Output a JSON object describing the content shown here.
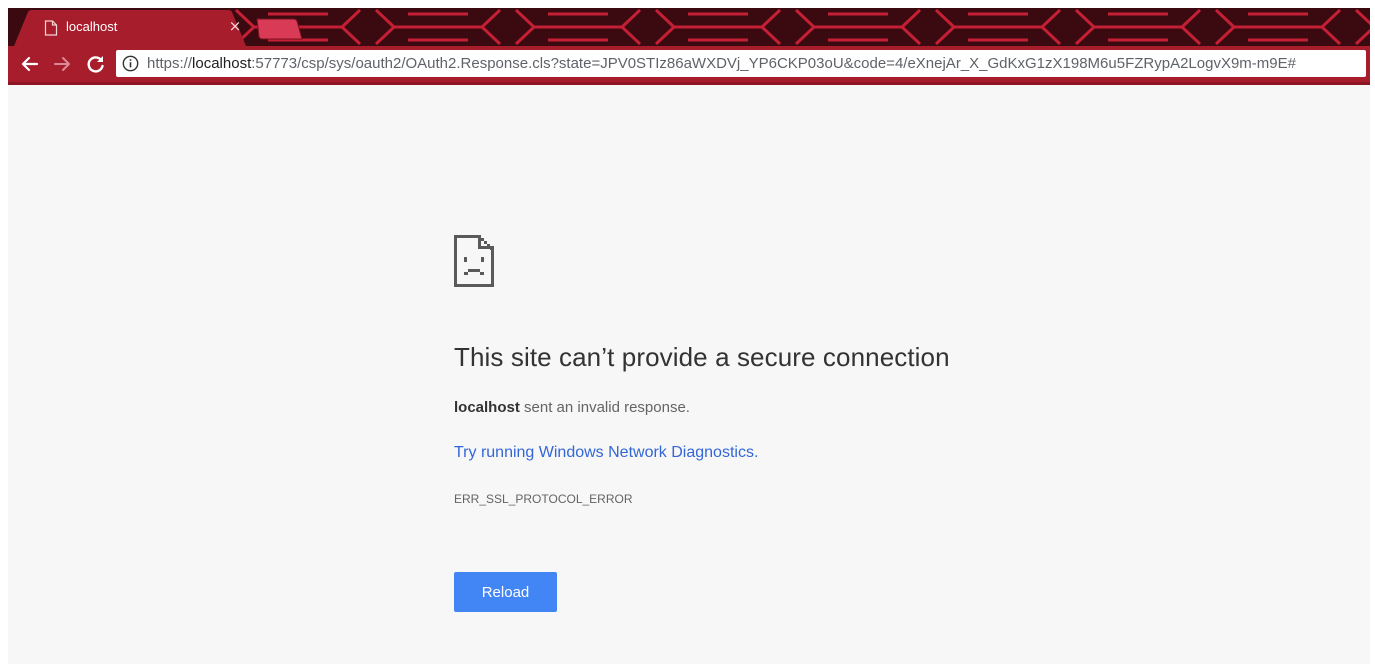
{
  "browser": {
    "tab": {
      "title": "localhost",
      "close_glyph": "×",
      "favicon": "page-icon"
    },
    "toolbar": {
      "back_icon": "arrow-left-icon",
      "forward_icon": "arrow-right-icon",
      "reload_icon": "reload-icon"
    },
    "omnibox": {
      "security_icon": "info-icon",
      "url_scheme": "https://",
      "url_host": "localhost",
      "url_rest": ":57773/csp/sys/oauth2/OAuth2.Response.cls?state=JPV0STIz86aWXDVj_YP6CKP03oU&code=4/eXnejAr_X_GdKxG1zX198M6u5FZRypA2LogvX9m-m9E#"
    },
    "theme_colors": {
      "tabstrip": "#3a0a10",
      "toolbar": "#a81d2c",
      "active_tab": "#a81d2c"
    }
  },
  "error_page": {
    "icon": "sad-page-icon",
    "heading": "This site can’t provide a secure connection",
    "host": "localhost",
    "description": " sent an invalid response.",
    "diagnostics_link": "Try running Windows Network Diagnostics.",
    "error_code": "ERR_SSL_PROTOCOL_ERROR",
    "reload_label": "Reload",
    "colors": {
      "background": "#f7f7f7",
      "link": "#3367d6",
      "button": "#4285f4"
    }
  }
}
